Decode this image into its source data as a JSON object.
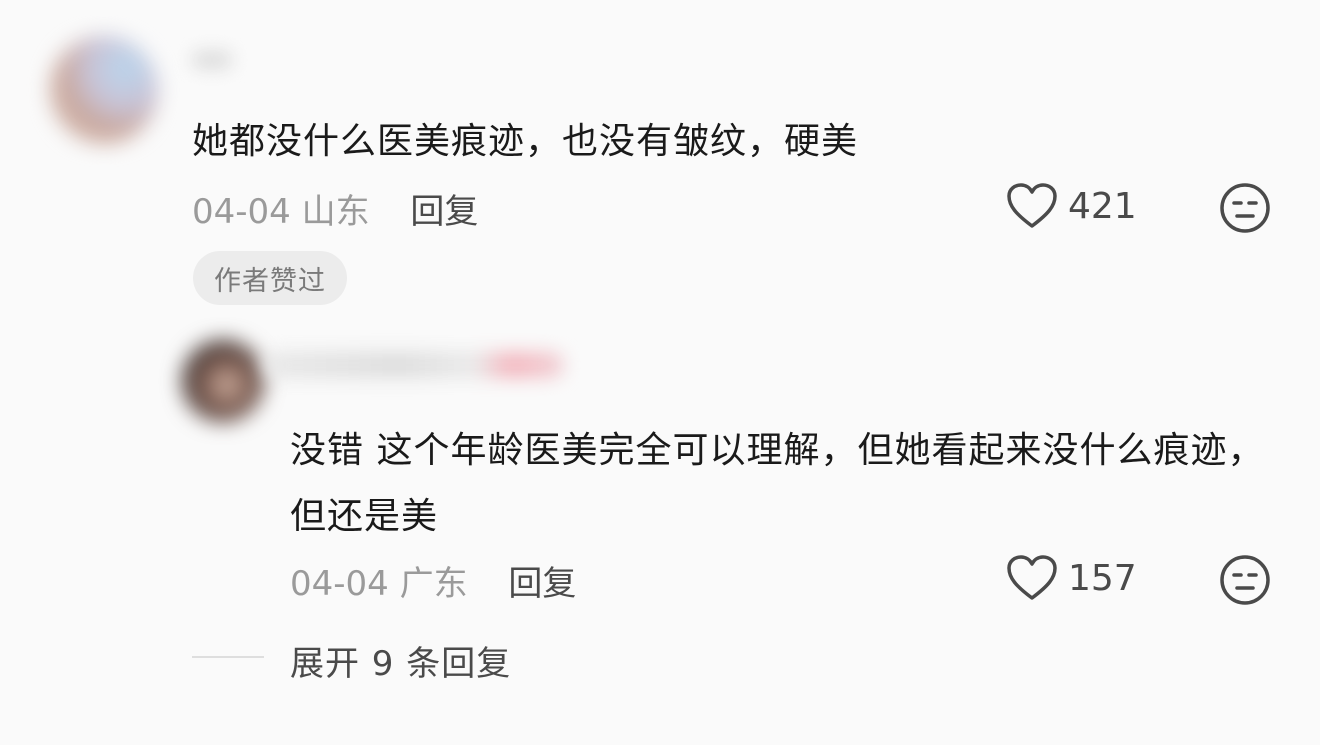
{
  "comments": [
    {
      "text": "她都没什么医美痕迹，也没有皱纹，硬美",
      "date": "04-04",
      "location": "山东",
      "reply_label": "回复",
      "likes": "421",
      "badge": "作者赞过",
      "like_icon": "heart-icon",
      "dislike_icon": "unamused-face-icon"
    },
    {
      "text": "没错 这个年龄医美完全可以理解，但她看起来没什么痕迹，但还是美",
      "date": "04-04",
      "location": "广东",
      "reply_label": "回复",
      "likes": "157",
      "like_icon": "heart-icon",
      "dislike_icon": "unamused-face-icon"
    }
  ],
  "expand_replies": "展开 9 条回复",
  "colors": {
    "background": "#fafafa",
    "text": "#1a1a1a",
    "meta": "#9a9a9a",
    "badge_bg": "#ececec"
  }
}
